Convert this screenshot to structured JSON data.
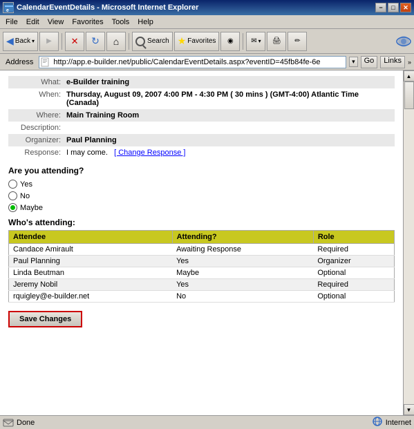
{
  "window": {
    "title": "CalendarEventDetails - Microsoft Internet Explorer",
    "min_label": "−",
    "max_label": "□",
    "close_label": "✕"
  },
  "menu": {
    "items": [
      "File",
      "Edit",
      "View",
      "Favorites",
      "Tools",
      "Help"
    ]
  },
  "toolbar": {
    "back_label": "Back",
    "forward_label": "▶",
    "stop_label": "✕",
    "refresh_label": "↻",
    "home_label": "⌂",
    "search_label": "Search",
    "favorites_label": "Favorites",
    "media_label": "◉",
    "print_label": "🖶",
    "edit_label": "✏"
  },
  "address_bar": {
    "label": "Address",
    "url": "http://app.e-builder.net/public/CalendarEventDetails.aspx?eventID=45fb84fe-6e",
    "go_label": "Go",
    "links_label": "Links",
    "chevron": "»"
  },
  "event": {
    "what_label": "What:",
    "what_value": "e-Builder training",
    "when_label": "When:",
    "when_value": "Thursday, August 09, 2007 4:00 PM - 4:30 PM ( 30 mins ) (GMT-4:00) Atlantic Time (Canada)",
    "where_label": "Where:",
    "where_value": "Main Training Room",
    "description_label": "Description:",
    "organizer_label": "Organizer:",
    "organizer_value": "Paul Planning",
    "response_label": "Response:",
    "response_value": "I may come.",
    "change_response_label": "[ Change Response ]"
  },
  "attendance": {
    "title": "Are you attending?",
    "options": [
      {
        "label": "Yes",
        "selected": false
      },
      {
        "label": "No",
        "selected": false
      },
      {
        "label": "Maybe",
        "selected": true
      }
    ]
  },
  "attendees": {
    "title": "Who's attending:",
    "columns": [
      "Attendee",
      "Attending?",
      "Role"
    ],
    "rows": [
      {
        "attendee": "Candace Amirault",
        "attending": "Awaiting Response",
        "role": "Required"
      },
      {
        "attendee": "Paul Planning",
        "attending": "Yes",
        "role": "Organizer"
      },
      {
        "attendee": "Linda Beutman",
        "attending": "Maybe",
        "role": "Optional"
      },
      {
        "attendee": "Jeremy Nobil",
        "attending": "Yes",
        "role": "Required"
      },
      {
        "attendee": "rquigley@e-builder.net",
        "attending": "No",
        "role": "Optional"
      }
    ]
  },
  "save_button": {
    "label": "Save Changes"
  },
  "status_bar": {
    "status": "Done",
    "zone": "Internet"
  }
}
